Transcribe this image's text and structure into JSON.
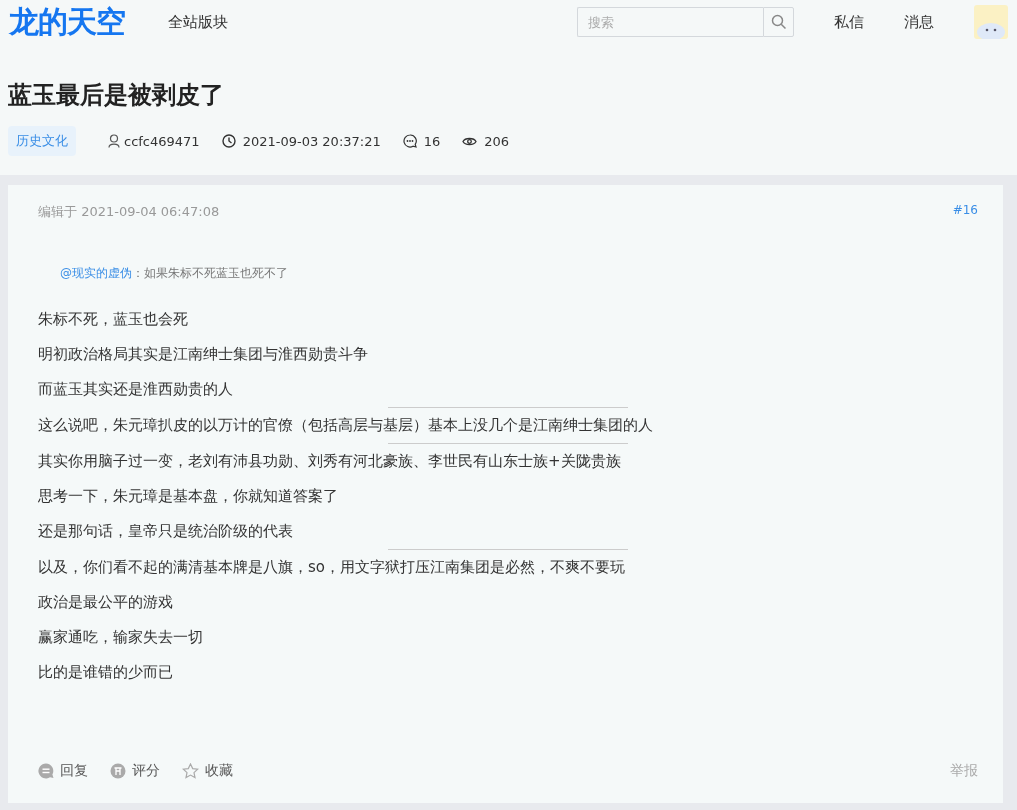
{
  "header": {
    "logo": "龙的天空",
    "nav": [
      "全站版块"
    ],
    "search": {
      "placeholder": "搜索"
    },
    "links": [
      "私信",
      "消息"
    ]
  },
  "post": {
    "title": "蓝玉最后是被剥皮了",
    "category": "历史文化",
    "author": "ccfc469471",
    "time": "2021-09-03 20:37:21",
    "comments": "16",
    "views": "206"
  },
  "reply": {
    "edited": "编辑于 2021-09-04 06:47:08",
    "floor": "#16",
    "quote": {
      "user": "@现实的虚伪",
      "sep": "：",
      "text": "如果朱标不死蓝玉也死不了"
    },
    "body": [
      {
        "kind": "text",
        "text": "朱标不死，蓝玉也会死"
      },
      {
        "kind": "text",
        "text": "明初政治格局其实是江南绅士集团与淮西勋贵斗争"
      },
      {
        "kind": "text",
        "text": "而蓝玉其实还是淮西勋贵的人"
      },
      {
        "kind": "divider"
      },
      {
        "kind": "text",
        "text": "这么说吧，朱元璋扒皮的以万计的官僚（包括高层与基层）基本上没几个是江南绅士集团的人"
      },
      {
        "kind": "divider"
      },
      {
        "kind": "text",
        "text": "其实你用脑子过一变，老刘有沛县功勋、刘秀有河北豪族、李世民有山东士族+关陇贵族"
      },
      {
        "kind": "text",
        "text": "思考一下，朱元璋是基本盘，你就知道答案了"
      },
      {
        "kind": "text",
        "text": "还是那句话，皇帝只是统治阶级的代表"
      },
      {
        "kind": "divider"
      },
      {
        "kind": "text",
        "text": "以及，你们看不起的满清基本牌是八旗，so，用文字狱打压江南集团是必然，不爽不要玩"
      },
      {
        "kind": "text",
        "text": "政治是最公平的游戏"
      },
      {
        "kind": "text",
        "text": "赢家通吃，输家失去一切"
      },
      {
        "kind": "text",
        "text": "比的是谁错的少而已"
      }
    ],
    "actions": [
      {
        "kind": "reply",
        "label": "回复"
      },
      {
        "kind": "rate",
        "label": "评分"
      },
      {
        "kind": "favorite",
        "label": "收藏"
      }
    ],
    "report": "举报"
  }
}
